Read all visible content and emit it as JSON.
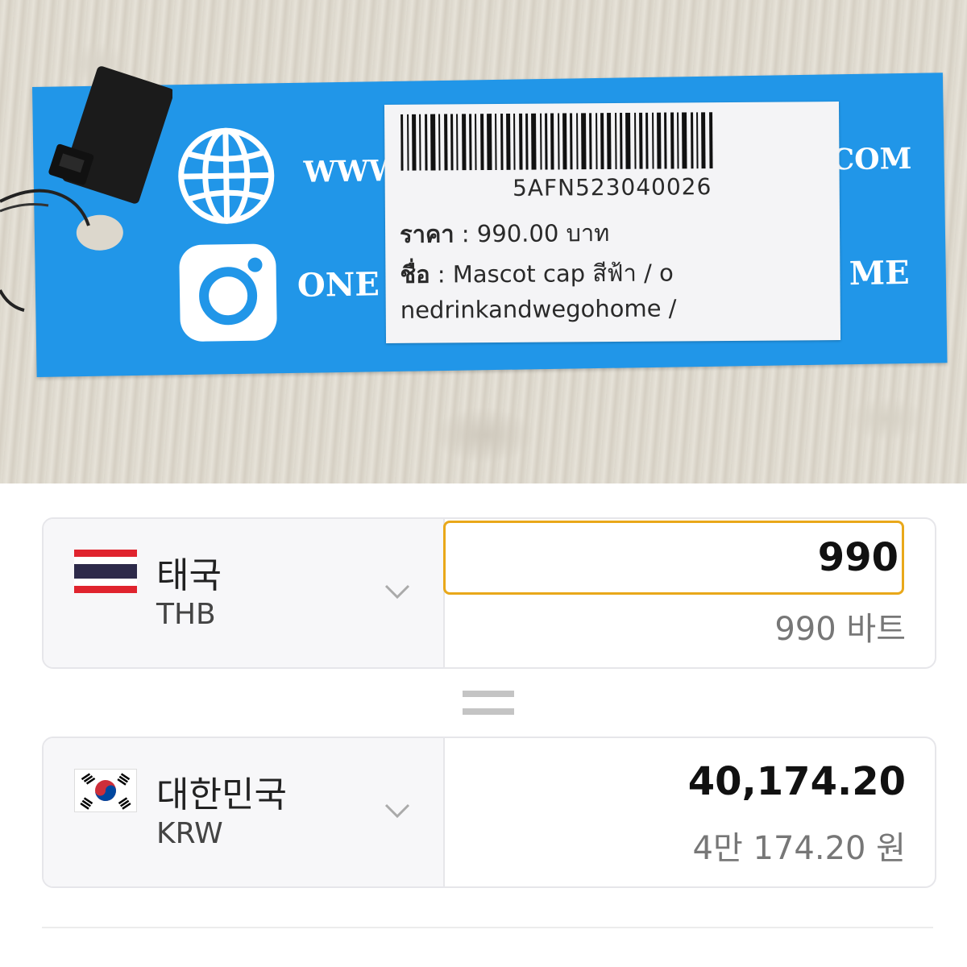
{
  "photo": {
    "tag_text": {
      "www": "WWW",
      "com": "COM",
      "one": "ONE",
      "me": "ME"
    },
    "label": {
      "code": "5AFN523040026",
      "price_key": "ราคา",
      "price_value": " : 990.00 บาท",
      "name_key": "ชื่อ",
      "name_value": " : Mascot cap สีฟ้า / o",
      "name_value2": "nedrinkandwegohome /"
    }
  },
  "converter": {
    "from": {
      "country": "태국",
      "currency": "THB",
      "input_value": "990",
      "amount_text": "990 바트"
    },
    "to": {
      "country": "대한민국",
      "currency": "KRW",
      "amount": "40,174.20",
      "amount_text": "4만 174.20 원"
    }
  },
  "colors": {
    "tag_blue": "#2196e8",
    "input_border": "#e9a81a"
  }
}
